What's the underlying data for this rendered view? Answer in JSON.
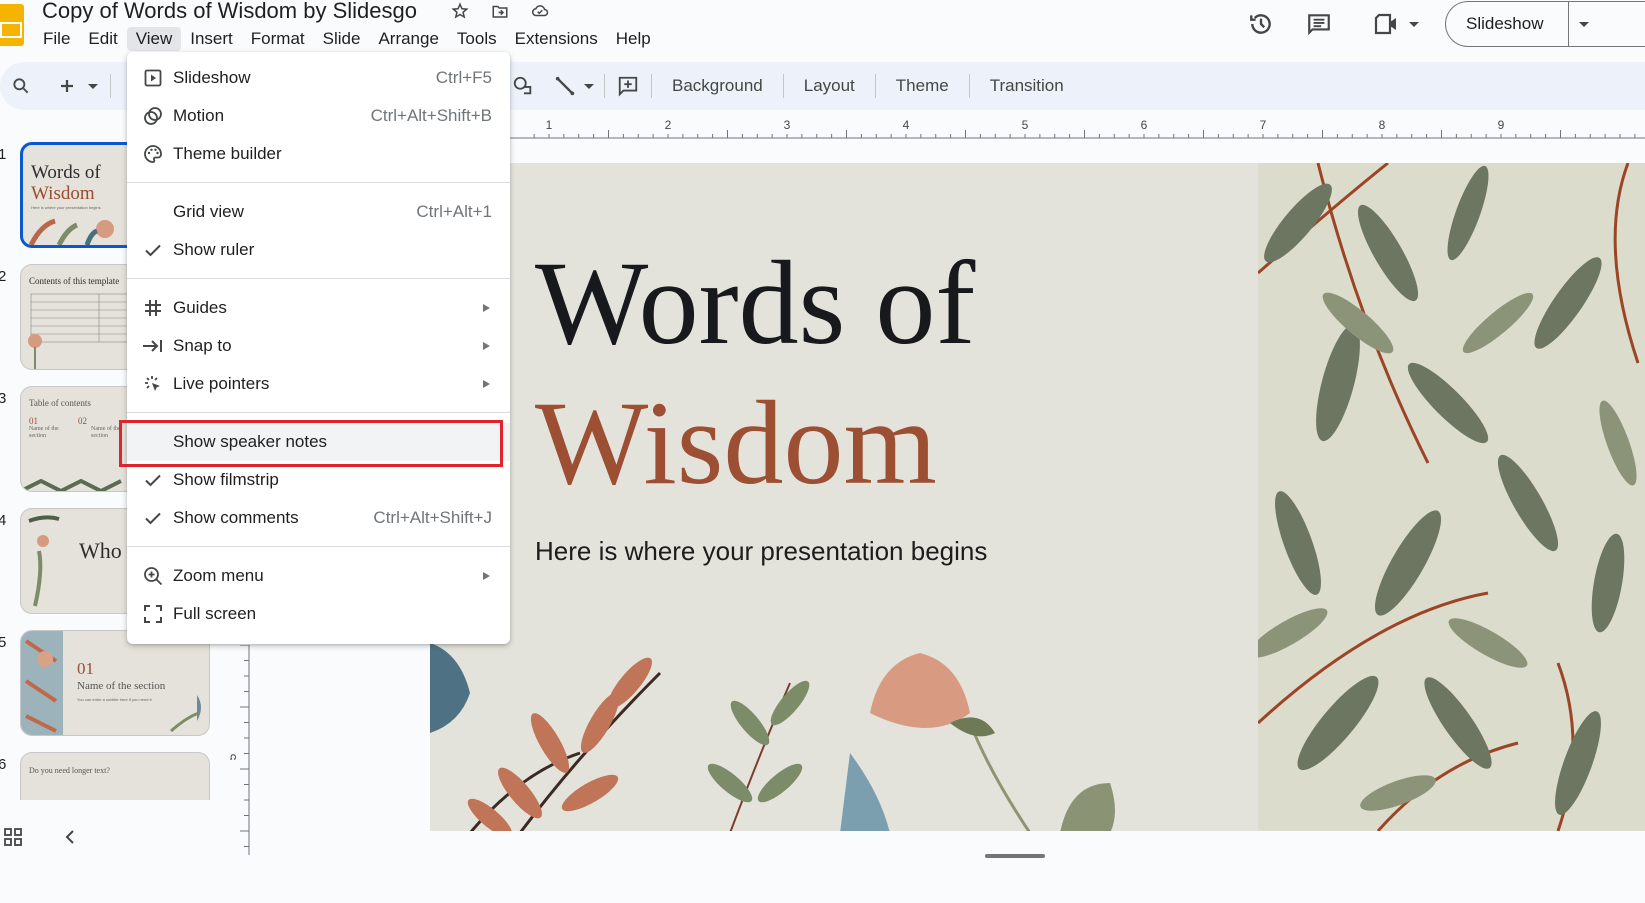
{
  "header": {
    "title": "Copy of Words of Wisdom by Slidesgo",
    "title_icons": [
      "star-icon",
      "move-to-folder-icon",
      "cloud-saved-icon"
    ],
    "menu": [
      "File",
      "Edit",
      "View",
      "Insert",
      "Format",
      "Slide",
      "Arrange",
      "Tools",
      "Extensions",
      "Help"
    ],
    "active_menu": "View",
    "right_icons": [
      "version-history-icon",
      "comments-icon",
      "meet-icon"
    ],
    "slideshow_label": "Slideshow"
  },
  "toolbar": {
    "left_icons": [
      "search-icon",
      "new-slide-icon",
      "undo-icon"
    ],
    "right_icons": [
      "shape-icon",
      "line-icon",
      "comment-add-icon"
    ],
    "buttons": [
      "Background",
      "Layout",
      "Theme",
      "Transition"
    ]
  },
  "ruler": {
    "horizontal_labels": [
      "1",
      "2",
      "3",
      "4",
      "5",
      "6",
      "7",
      "8",
      "9"
    ],
    "vertical_labels": [
      "5"
    ]
  },
  "view_menu": {
    "groups": [
      [
        {
          "label": "Slideshow",
          "shortcut": "Ctrl+F5",
          "icon": "slideshow-icon"
        },
        {
          "label": "Motion",
          "shortcut": "Ctrl+Alt+Shift+B",
          "icon": "motion-icon"
        },
        {
          "label": "Theme builder",
          "shortcut": "",
          "icon": "palette-icon"
        }
      ],
      [
        {
          "label": "Grid view",
          "shortcut": "Ctrl+Alt+1",
          "icon": ""
        },
        {
          "label": "Show ruler",
          "shortcut": "",
          "icon": "check-icon",
          "checked": true
        }
      ],
      [
        {
          "label": "Guides",
          "shortcut": "",
          "icon": "guides-icon",
          "submenu": true
        },
        {
          "label": "Snap to",
          "shortcut": "",
          "icon": "snap-to-icon",
          "submenu": true
        },
        {
          "label": "Live pointers",
          "shortcut": "",
          "icon": "live-pointers-icon",
          "submenu": true
        }
      ],
      [
        {
          "label": "Show speaker notes",
          "shortcut": "",
          "icon": "",
          "highlighted": true
        },
        {
          "label": "Show filmstrip",
          "shortcut": "",
          "icon": "check-icon",
          "checked": true
        },
        {
          "label": "Show comments",
          "shortcut": "Ctrl+Alt+Shift+J",
          "icon": "check-icon",
          "checked": true
        }
      ],
      [
        {
          "label": "Zoom menu",
          "shortcut": "",
          "icon": "zoom-in-icon",
          "submenu": true
        },
        {
          "label": "Full screen",
          "shortcut": "",
          "icon": "fullscreen-icon"
        }
      ]
    ]
  },
  "filmstrip": {
    "slides": [
      {
        "number": "1",
        "title": "Words of",
        "accent": "Wisdom",
        "subtitle": "Here is where your presentation begins",
        "selected": true
      },
      {
        "number": "2",
        "title": "Contents of this template"
      },
      {
        "number": "3",
        "title": "Table of contents",
        "items": [
          "01",
          "02"
        ],
        "item_label": "Name of the section"
      },
      {
        "number": "4",
        "title": "Who"
      },
      {
        "number": "5",
        "accent": "01",
        "title": "Name of the section",
        "subtitle": "You can enter a subtitle here if you need it"
      },
      {
        "number": "6",
        "title": "Do you need longer text?"
      }
    ]
  },
  "slide": {
    "title_line1": "Words of",
    "title_line2": "Wisdom",
    "subtitle": "Here is where your presentation begins",
    "colors": {
      "title": "#17191c",
      "accent": "#9c4f32",
      "background": "#e4e3db"
    }
  },
  "highlight_color": "#e0242d"
}
